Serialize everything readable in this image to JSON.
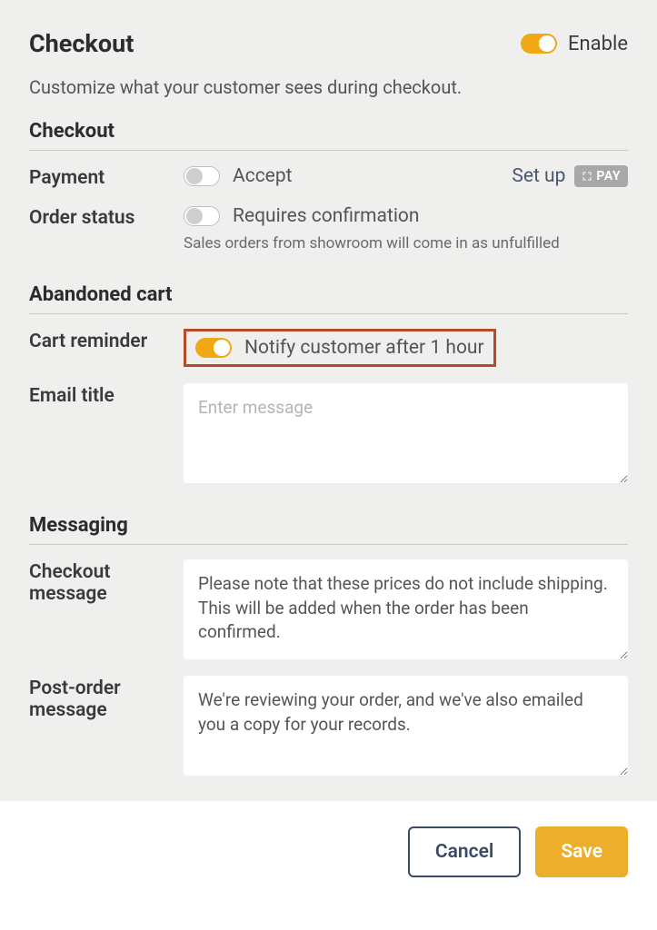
{
  "header": {
    "title": "Checkout",
    "enable_label": "Enable"
  },
  "subtitle": "Customize what your customer sees during checkout.",
  "sections": {
    "checkout": {
      "title": "Checkout",
      "payment": {
        "label": "Payment",
        "toggle_text": "Accept",
        "setup_link": "Set up",
        "pay_badge": "PAY"
      },
      "order_status": {
        "label": "Order status",
        "toggle_text": "Requires confirmation",
        "helper": "Sales orders from showroom will come in as unfulfilled"
      }
    },
    "abandoned": {
      "title": "Abandoned cart",
      "cart_reminder": {
        "label": "Cart reminder",
        "toggle_text": "Notify customer after 1 hour"
      },
      "email_title": {
        "label": "Email title",
        "placeholder": "Enter message",
        "value": ""
      }
    },
    "messaging": {
      "title": "Messaging",
      "checkout_message": {
        "label": "Checkout message",
        "value": "Please note that these prices do not include shipping. This will be added when the order has been confirmed."
      },
      "post_order_message": {
        "label": "Post-order message",
        "value": "We're reviewing your order, and we've also emailed you a copy for your records."
      }
    }
  },
  "footer": {
    "cancel": "Cancel",
    "save": "Save"
  }
}
